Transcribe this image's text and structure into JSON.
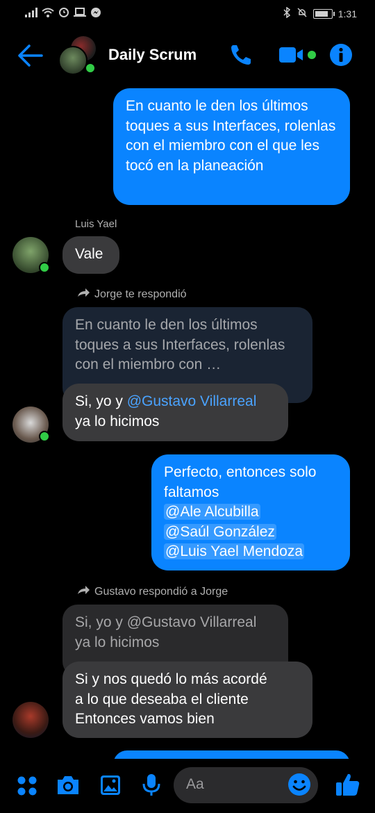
{
  "status_bar": {
    "time": "1:31"
  },
  "header": {
    "title": "Daily Scrum"
  },
  "colors": {
    "accent": "#0a84ff",
    "online": "#31cc46",
    "incoming_bubble": "#3a3a3c"
  },
  "messages": {
    "m1": {
      "text": "En cuanto le den los últimos toques a sus Interfaces, rolenlas con el miembro con el que les tocó en la planeación"
    },
    "m2": {
      "sender": "Luis Yael",
      "text": "Vale"
    },
    "m3": {
      "reply_note": "Jorge te respondió",
      "quoted": "En cuanto le den los últimos toques a sus Interfaces, rolenlas con el miembro con …",
      "text_before": "Si, yo y ",
      "mention": "@Gustavo Villarreal",
      "text_after": "ya lo hicimos"
    },
    "m4": {
      "text": "Perfecto, entonces solo faltamos",
      "mentions": [
        "@Ale Alcubilla",
        "@Saúl González",
        "@Luis Yael Mendoza"
      ]
    },
    "m5": {
      "reply_note": "Gustavo respondió a Jorge",
      "quoted_line1": "Si, yo y @Gustavo Villarreal",
      "quoted_line2": "ya lo hicimos",
      "line1": "Si y nos quedó lo más acordé",
      "line2": "a lo que deseaba el cliente",
      "line3": "Entonces vamos bien"
    }
  },
  "composer": {
    "placeholder": "Aa"
  }
}
